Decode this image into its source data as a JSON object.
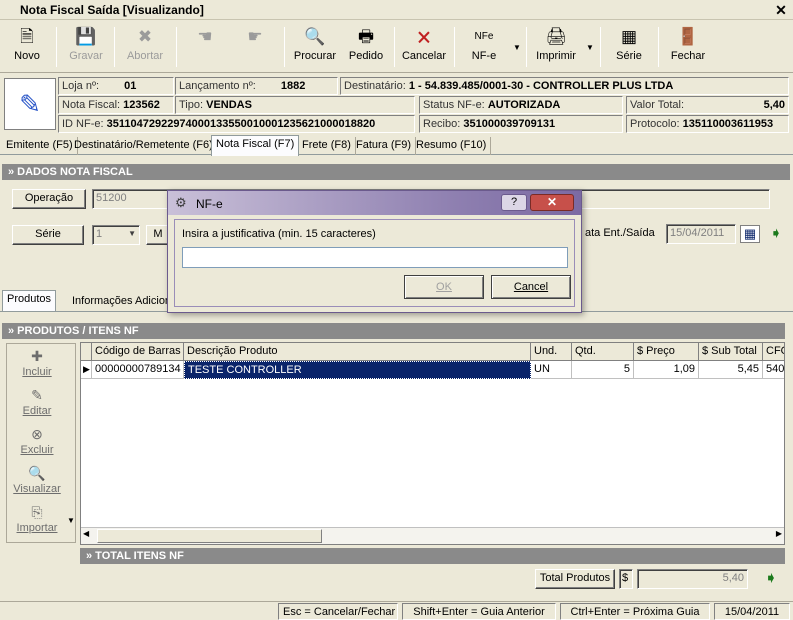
{
  "window": {
    "title": "Nota Fiscal Saída [Visualizando]",
    "close": "✕"
  },
  "toolbar": {
    "novo": "Novo",
    "gravar": "Gravar",
    "abortar": "Abortar",
    "procurar": "Procurar",
    "pedido": "Pedido",
    "cancelar": "Cancelar",
    "nfe": "NF-e",
    "nfe_icon_text": "NFe",
    "imprimir": "Imprimir",
    "serie": "Série",
    "fechar": "Fechar"
  },
  "header": {
    "loja_label": "Loja nº:",
    "loja_value": "01",
    "lancamento_label": "Lançamento nº:",
    "lancamento_value": "1882",
    "destinatario_label": "Destinatário:",
    "destinatario_value": "1 - 54.839.485/0001-30 - CONTROLLER PLUS  LTDA",
    "nota_label": "Nota Fiscal:",
    "nota_value": "123562",
    "tipo_label": "Tipo:",
    "tipo_value": "VENDAS",
    "status_label": "Status NF-e:",
    "status_value": "AUTORIZADA",
    "valor_label": "Valor Total:",
    "valor_value": "5,40",
    "idnfe_label": "ID NF-e:",
    "idnfe_value": "35110472922974000133550010001235621000018820",
    "recibo_label": "Recibo:",
    "recibo_value": "351000039709131",
    "protocolo_label": "Protocolo:",
    "protocolo_value": "135110003611953"
  },
  "tabs": [
    "Emitente (F5)",
    "Destinatário/Remetente (F6)",
    "Nota Fiscal (F7)",
    "Frete (F8)",
    "Fatura (F9)",
    "Resumo (F10)"
  ],
  "section_dados": "» DADOS NOTA FISCAL",
  "operacao": {
    "label": "Operação",
    "value": "51200"
  },
  "serie": {
    "label": "Série",
    "value": "1"
  },
  "data_label": "ata Ent./Saída",
  "data_value": "15/04/2011",
  "inner_tabs": [
    "Produtos",
    "Informações Adicion"
  ],
  "section_produtos": "» PRODUTOS / ITENS NF",
  "side_tools": [
    "Incluir",
    "Editar",
    "Excluir",
    "Visualizar",
    "Importar"
  ],
  "grid": {
    "columns": [
      "Código de Barras",
      "Descrição Produto",
      "Und.",
      "Qtd.",
      "$ Preço",
      "$ Sub Total",
      "CFO"
    ],
    "rows": [
      {
        "codigo": "00000000789134",
        "descricao": "TESTE CONTROLLER",
        "und": "UN",
        "qtd": "5",
        "preco": "1,09",
        "subtotal": "5,45",
        "cfo": "540"
      }
    ]
  },
  "section_total": "» TOTAL ITENS NF",
  "total": {
    "label": "Total Produtos",
    "currency": "$",
    "value": "5,40"
  },
  "status_bar": [
    "Esc = Cancelar/Fechar",
    "Shift+Enter = Guia Anterior",
    "Ctrl+Enter = Próxima Guia",
    "15/04/2011"
  ],
  "dialog": {
    "title": "NF-e",
    "prompt": "Insira a justificativa (min. 15 caracteres)",
    "input_value": "",
    "ok": "OK",
    "cancel": "Cancel",
    "help": "?",
    "close": "✕"
  }
}
